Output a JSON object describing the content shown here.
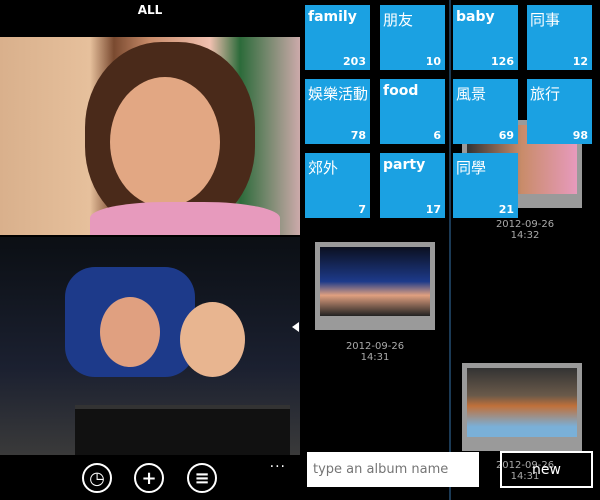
{
  "left_panel": {
    "title": "ALL",
    "more_label": "...",
    "appbar": [
      {
        "icon": "clock-icon",
        "glyph": "◷"
      },
      {
        "icon": "add-icon",
        "glyph": "+"
      },
      {
        "icon": "list-icon",
        "glyph": "≡"
      }
    ]
  },
  "right_panel": {
    "accent_color": "#1ba1e2",
    "albums": [
      {
        "name": "family",
        "count": "203"
      },
      {
        "name": "朋友",
        "count": "10"
      },
      {
        "name": "baby",
        "count": "126"
      },
      {
        "name": "同事",
        "count": "12"
      },
      {
        "name": "娛樂活動",
        "count": "78"
      },
      {
        "name": "food",
        "count": "6"
      },
      {
        "name": "風景",
        "count": "69"
      },
      {
        "name": "旅行",
        "count": "98"
      },
      {
        "name": "郊外",
        "count": "7"
      },
      {
        "name": "party",
        "count": "17"
      },
      {
        "name": "同學",
        "count": "21"
      }
    ],
    "timeline": [
      {
        "date": "2012-09-26",
        "time": "14:32"
      },
      {
        "date": "2012-09-26",
        "time": "14:31"
      },
      {
        "date": "2012-09-26",
        "time": "14:31"
      }
    ],
    "album_input": {
      "value": "",
      "placeholder": "type an album name"
    },
    "new_label": "new"
  }
}
